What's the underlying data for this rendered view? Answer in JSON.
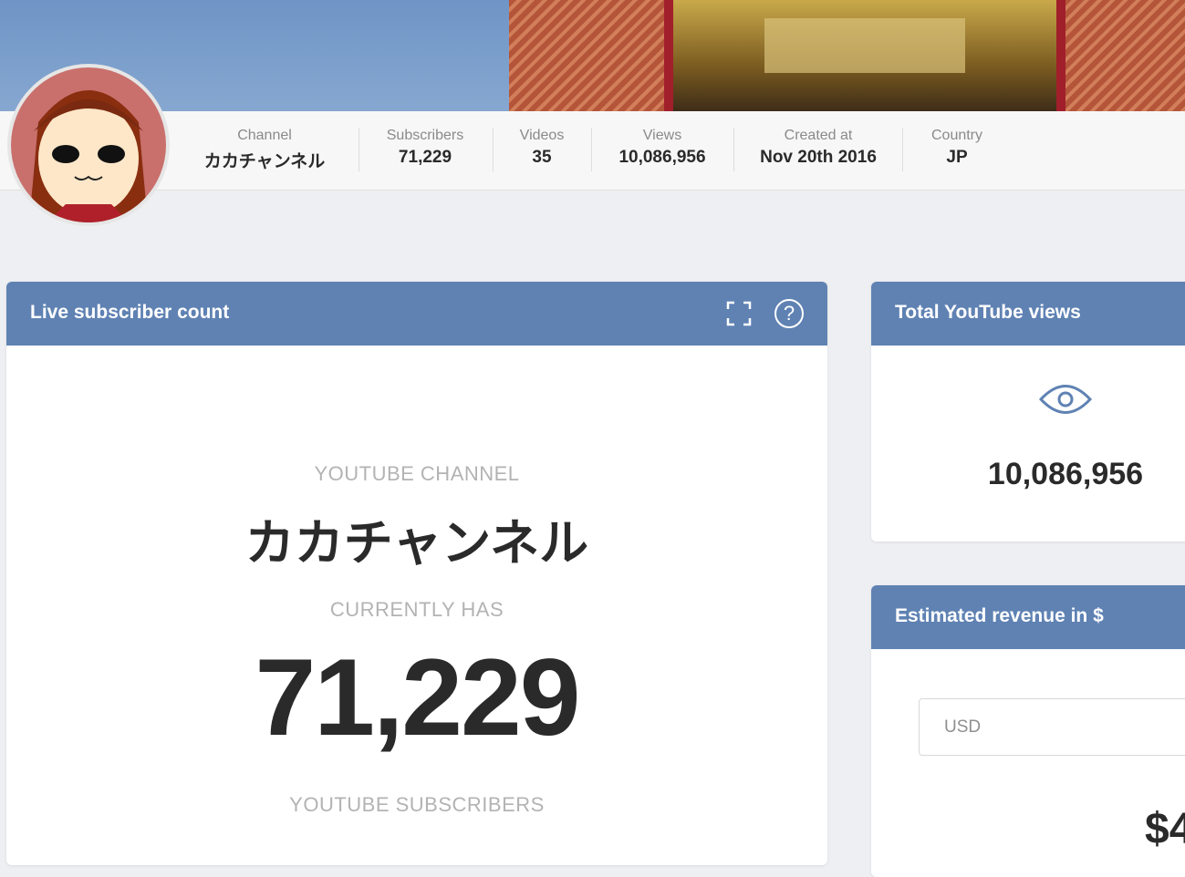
{
  "channel": {
    "label": "Channel",
    "name": "カカチャンネル"
  },
  "stats": [
    {
      "label": "Subscribers",
      "value": "71,229"
    },
    {
      "label": "Videos",
      "value": "35"
    },
    {
      "label": "Views",
      "value": "10,086,956"
    },
    {
      "label": "Created at",
      "value": "Nov 20th 2016"
    },
    {
      "label": "Country",
      "value": "JP"
    }
  ],
  "live": {
    "title": "Live subscriber count",
    "kicker": "YOUTUBE CHANNEL",
    "name": "カカチャンネル",
    "currently": "CURRENTLY HAS",
    "count": "71,229",
    "footer": "YOUTUBE SUBSCRIBERS"
  },
  "views_card": {
    "title": "Total YouTube views",
    "value": "10,086,956"
  },
  "revenue": {
    "title": "Estimated revenue in $",
    "currency": "USD",
    "amount": "$4"
  },
  "colors": {
    "accent": "#5f82b3"
  }
}
